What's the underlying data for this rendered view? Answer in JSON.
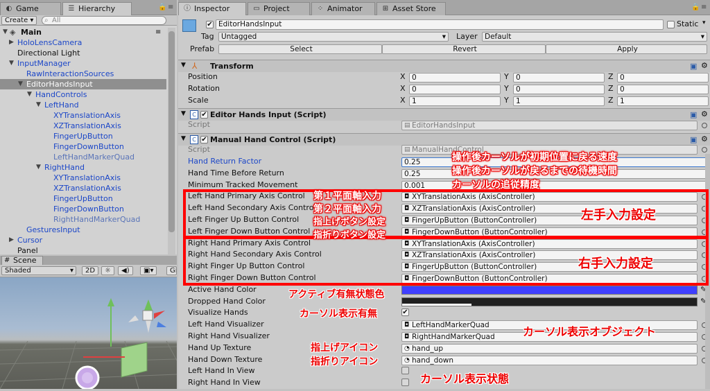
{
  "tabs": {
    "game": "Game",
    "hierarchy": "Hierarchy",
    "inspector": "Inspector",
    "project": "Project",
    "animator": "Animator",
    "asset_store": "Asset Store"
  },
  "hierarchy": {
    "create": "Create",
    "search_placeholder": "All",
    "items": [
      {
        "label": "Main",
        "depth": 0
      },
      {
        "label": "HoloLensCamera",
        "depth": 1
      },
      {
        "label": "Directional Light",
        "depth": 1
      },
      {
        "label": "InputManager",
        "depth": 1
      },
      {
        "label": "RawInteractionSources",
        "depth": 2
      },
      {
        "label": "EditorHandsInput",
        "depth": 2
      },
      {
        "label": "HandControls",
        "depth": 3
      },
      {
        "label": "LeftHand",
        "depth": 4
      },
      {
        "label": "XYTranslationAxis",
        "depth": 5
      },
      {
        "label": "XZTranslationAxis",
        "depth": 5
      },
      {
        "label": "FingerUpButton",
        "depth": 5
      },
      {
        "label": "FingerDownButton",
        "depth": 5
      },
      {
        "label": "LeftHandMarkerQuad",
        "depth": 5
      },
      {
        "label": "RightHand",
        "depth": 4
      },
      {
        "label": "XYTranslationAxis",
        "depth": 5
      },
      {
        "label": "XZTranslationAxis",
        "depth": 5
      },
      {
        "label": "FingerUpButton",
        "depth": 5
      },
      {
        "label": "FingerDownButton",
        "depth": 5
      },
      {
        "label": "RightHandMarkerQuad",
        "depth": 5
      },
      {
        "label": "GesturesInput",
        "depth": 2
      },
      {
        "label": "Cursor",
        "depth": 1
      },
      {
        "label": "Panel",
        "depth": 1
      }
    ]
  },
  "scene": {
    "tab": "Scene",
    "shading": "Shaded",
    "mode_2d": "2D",
    "gizmos": "Gi"
  },
  "inspector": {
    "object_name": "EditorHandsInput",
    "static_label": "Static",
    "tag_label": "Tag",
    "tag_value": "Untagged",
    "layer_label": "Layer",
    "layer_value": "Default",
    "prefab_label": "Prefab",
    "prefab_select": "Select",
    "prefab_revert": "Revert",
    "prefab_apply": "Apply",
    "transform": {
      "title": "Transform",
      "position_label": "Position",
      "rotation_label": "Rotation",
      "scale_label": "Scale",
      "x": "X",
      "y": "Y",
      "z": "Z",
      "position": [
        "0",
        "0",
        "0"
      ],
      "rotation": [
        "0",
        "0",
        "0"
      ],
      "scale": [
        "1",
        "1",
        "1"
      ]
    },
    "editor_hands": {
      "title": "Editor Hands Input (Script)",
      "script_label": "Script",
      "script_value": "EditorHandsInput"
    },
    "manual_hand": {
      "title": "Manual Hand Control (Script)",
      "script_label": "Script",
      "script_value": "ManualHandControl",
      "rows": [
        {
          "label": "Hand Return Factor",
          "value": "0.25"
        },
        {
          "label": "Hand Time Before Return",
          "value": "0.25"
        },
        {
          "label": "Minimum Tracked Movement",
          "value": "0.001"
        },
        {
          "label": "Left Hand Primary Axis Control",
          "value": "XYTranslationAxis (AxisController)"
        },
        {
          "label": "Left Hand Secondary Axis Control",
          "value": "XZTranslationAxis (AxisController)"
        },
        {
          "label": "Left Finger Up Button Control",
          "value": "FingerUpButton (ButtonController)"
        },
        {
          "label": "Left Finger Down Button Control",
          "value": "FingerDownButton (ButtonController)"
        },
        {
          "label": "Right Hand Primary Axis Control",
          "value": "XYTranslationAxis (AxisController)"
        },
        {
          "label": "Right Hand Secondary Axis Control",
          "value": "XZTranslationAxis (AxisController)"
        },
        {
          "label": "Right Finger Up Button Control",
          "value": "FingerUpButton (ButtonController)"
        },
        {
          "label": "Right Finger Down Button Control",
          "value": "FingerDownButton (ButtonController)"
        },
        {
          "label": "Active Hand Color",
          "value": ""
        },
        {
          "label": "Dropped Hand Color",
          "value": ""
        },
        {
          "label": "Visualize Hands",
          "value": "✔"
        },
        {
          "label": "Left Hand Visualizer",
          "value": "LeftHandMarkerQuad"
        },
        {
          "label": "Right Hand Visualizer",
          "value": "RightHandMarkerQuad"
        },
        {
          "label": "Hand Up Texture",
          "value": "hand_up"
        },
        {
          "label": "Hand Down Texture",
          "value": "hand_down"
        },
        {
          "label": "Left Hand In View",
          "value": ""
        },
        {
          "label": "Right Hand In View",
          "value": ""
        }
      ]
    }
  },
  "annotations": {
    "speed": "操作後カーソルが初期位置に戻る速度",
    "wait": "操作後カーソルが戻るまでの待機時間",
    "precision": "カーソルの追従精度",
    "primary": "第１平面軸入力",
    "secondary": "第２平面軸入力",
    "finger_up": "指上げボタン設定",
    "finger_down": "指折りボタン設定",
    "left_input": "左手入力設定",
    "right_input": "右手入力設定",
    "active_color": "アクティブ有無状態色",
    "cursor_show": "カーソル表示有無",
    "cursor_object": "カーソル表示オブジェクト",
    "up_icon": "指上げアイコン",
    "down_icon": "指折りアイコン",
    "cursor_state": "カーソル表示状態"
  },
  "colors": {
    "active_hand": "#4040ff",
    "dropped_hand": "#202020",
    "annotation_red": "#ff0000"
  }
}
